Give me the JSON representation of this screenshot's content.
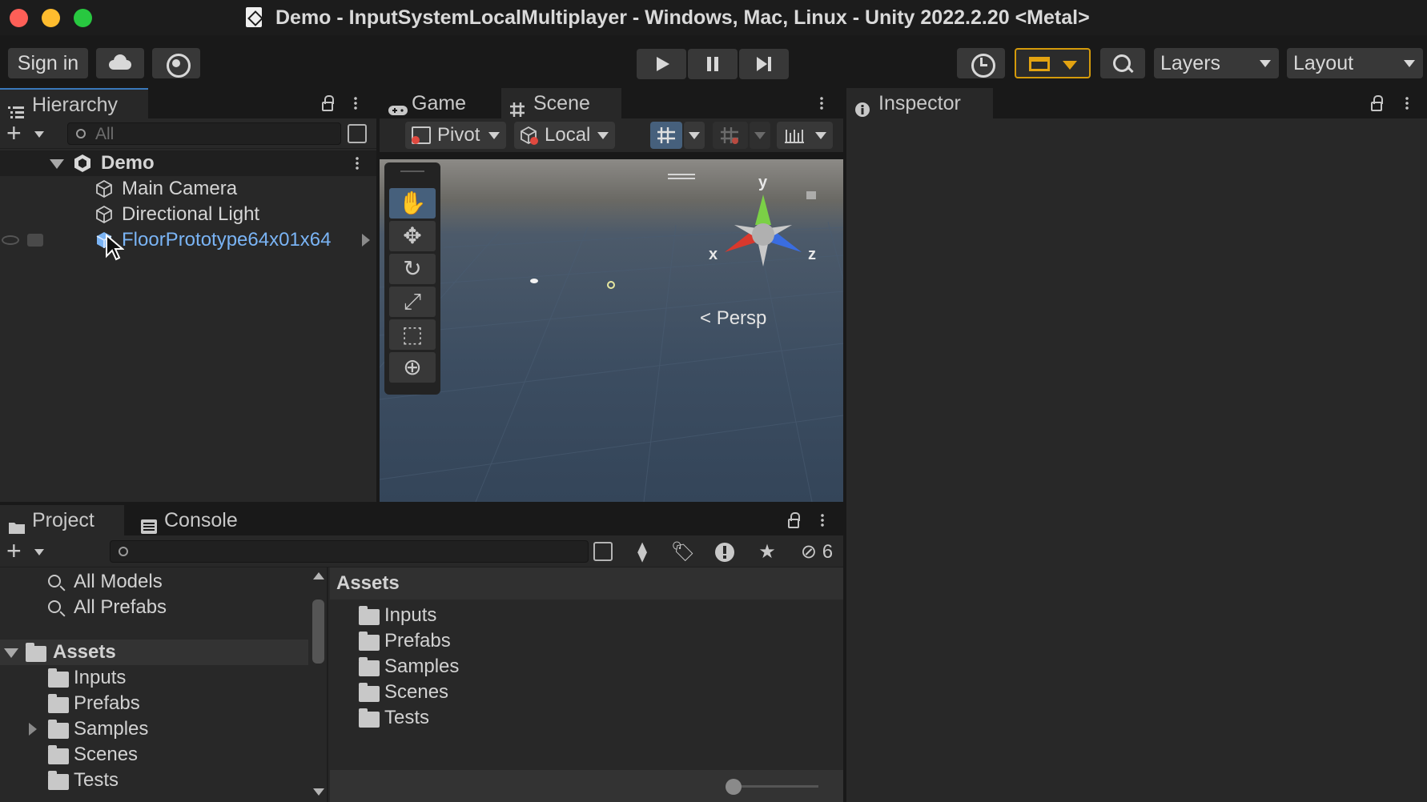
{
  "window": {
    "title": "Demo - InputSystemLocalMultiplayer - Windows, Mac, Linux - Unity 2022.2.20 <Metal>"
  },
  "toolbar": {
    "sign_in": "Sign in",
    "layers": "Layers",
    "layout": "Layout"
  },
  "hierarchy": {
    "tab": "Hierarchy",
    "search_placeholder": "All",
    "scene_name": "Demo",
    "items": [
      {
        "label": "Main Camera"
      },
      {
        "label": "Directional Light"
      },
      {
        "label": "FloorPrototype64x01x64"
      }
    ]
  },
  "scene_view": {
    "tabs": [
      "Game",
      "Scene"
    ],
    "pivot": "Pivot",
    "local": "Local",
    "projection": "Persp",
    "axes": {
      "x": "x",
      "y": "y",
      "z": "z"
    }
  },
  "inspector": {
    "tab": "Inspector"
  },
  "project": {
    "tabs": [
      "Project",
      "Console"
    ],
    "hidden_count": "6",
    "tree": {
      "favorites": [
        "All Models",
        "All Prefabs"
      ],
      "root": "Assets",
      "folders": [
        "Inputs",
        "Prefabs",
        "Samples",
        "Scenes",
        "Tests"
      ]
    },
    "content": {
      "header": "Assets",
      "folders": [
        "Inputs",
        "Prefabs",
        "Samples",
        "Scenes",
        "Tests"
      ]
    }
  },
  "colors": {
    "accent_selected": "#46607c",
    "prefab_blue": "#7ab4f5",
    "account_gold": "#e3a311"
  }
}
